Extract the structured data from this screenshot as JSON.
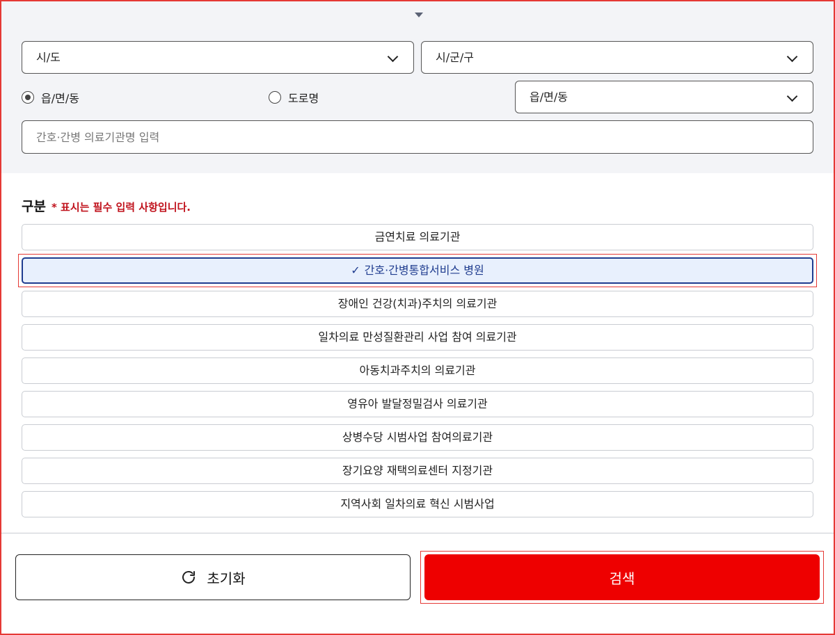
{
  "filters": {
    "sido": {
      "label": "시/도"
    },
    "sigungu": {
      "label": "시/군/구"
    },
    "address_type": {
      "options": [
        {
          "label": "읍/면/동",
          "selected": true
        },
        {
          "label": "도로명",
          "selected": false
        }
      ]
    },
    "dong": {
      "label": "읍/면/동"
    },
    "name_input": {
      "placeholder": "간호·간병 의료기관명 입력",
      "value": ""
    }
  },
  "category": {
    "title": "구분",
    "required_note": "* 표시는 필수 입력 사항입니다.",
    "items": [
      {
        "label": "금연치료 의료기관",
        "selected": false
      },
      {
        "label": "간호·간병통합서비스 병원",
        "selected": true
      },
      {
        "label": "장애인 건강(치과)주치의 의료기관",
        "selected": false
      },
      {
        "label": "일차의료 만성질환관리 사업 참여 의료기관",
        "selected": false
      },
      {
        "label": "아동치과주치의 의료기관",
        "selected": false
      },
      {
        "label": "영유아 발달정밀검사 의료기관",
        "selected": false
      },
      {
        "label": "상병수당 시범사업 참여의료기관",
        "selected": false
      },
      {
        "label": "장기요양 재택의료센터 지정기관",
        "selected": false
      },
      {
        "label": "지역사회 일차의료 혁신 시범사업",
        "selected": false
      }
    ]
  },
  "actions": {
    "reset_label": "초기화",
    "search_label": "검색"
  },
  "colors": {
    "accent_red": "#ee0000",
    "selected_blue": "#1f3c8f",
    "note_red": "#c0121c"
  }
}
